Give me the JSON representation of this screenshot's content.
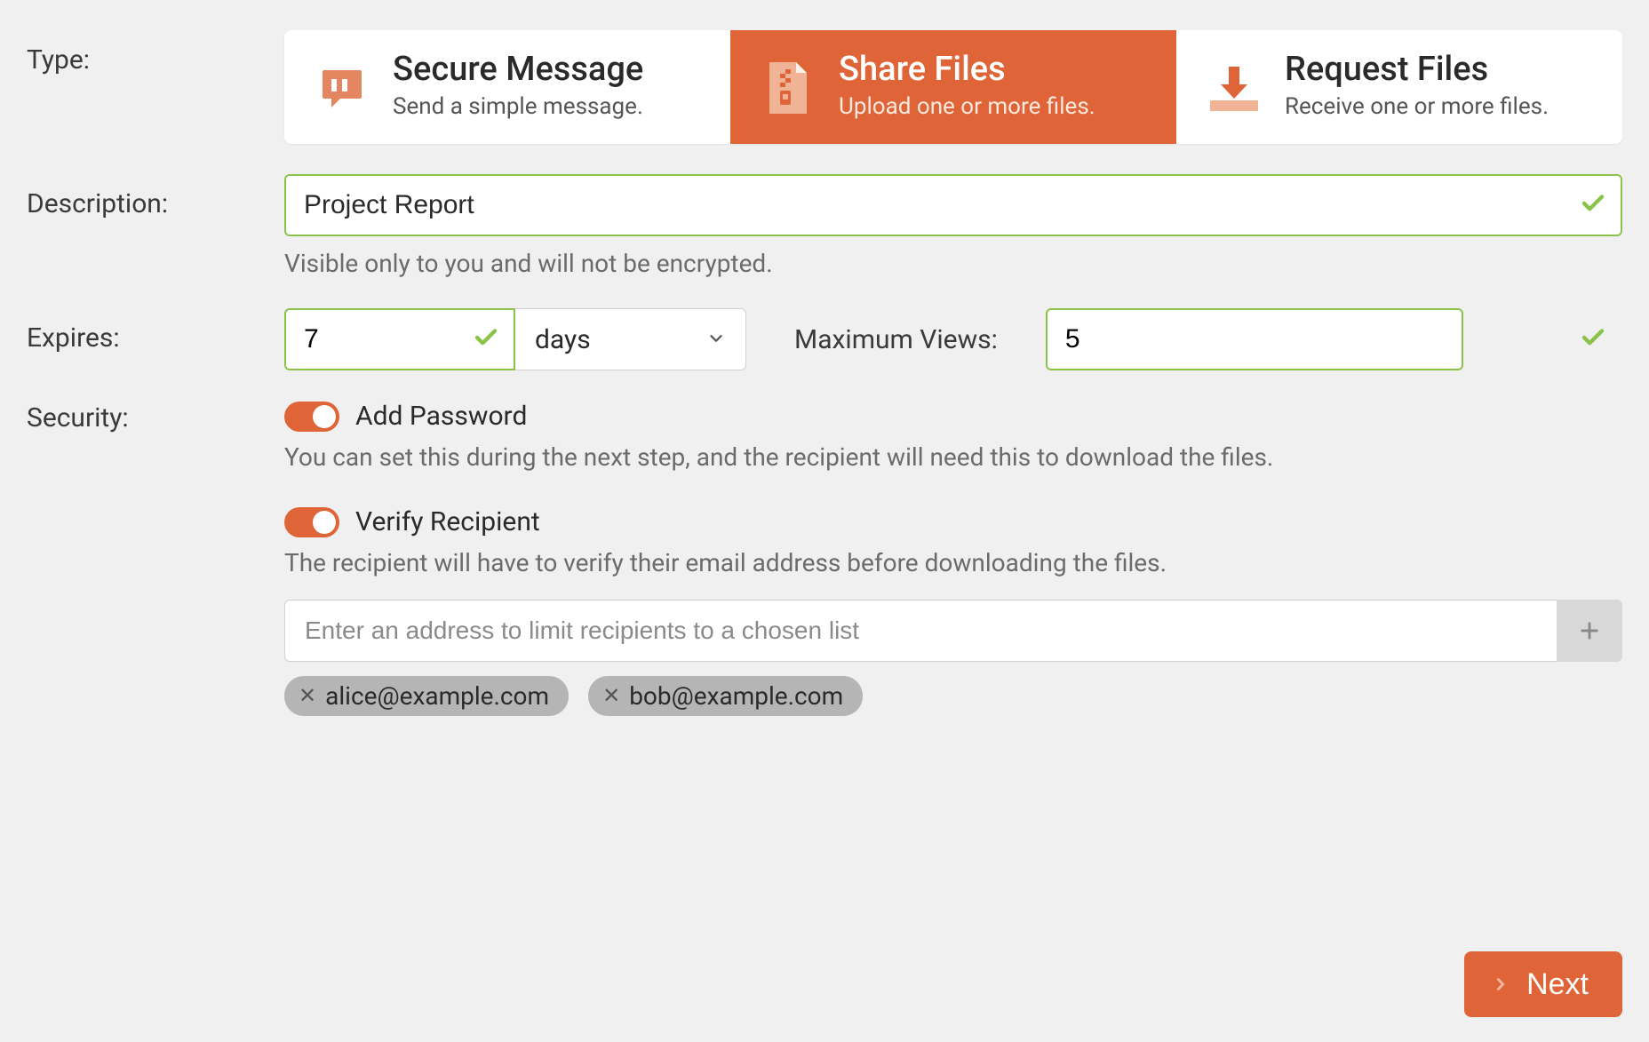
{
  "labels": {
    "type": "Type:",
    "description": "Description:",
    "expires": "Expires:",
    "max_views": "Maximum Views:",
    "security": "Security:"
  },
  "type_options": [
    {
      "title": "Secure Message",
      "subtitle": "Send a simple message.",
      "selected": false
    },
    {
      "title": "Share Files",
      "subtitle": "Upload one or more files.",
      "selected": true
    },
    {
      "title": "Request Files",
      "subtitle": "Receive one or more files.",
      "selected": false
    }
  ],
  "description": {
    "value": "Project Report",
    "hint": "Visible only to you and will not be encrypted.",
    "valid": true
  },
  "expires": {
    "value": "7",
    "unit": "days",
    "valid": true
  },
  "max_views": {
    "value": "5",
    "valid": true
  },
  "security": {
    "add_password": {
      "label": "Add Password",
      "enabled": true,
      "hint": "You can set this during the next step, and the recipient will need this to download the files."
    },
    "verify_recipient": {
      "label": "Verify Recipient",
      "enabled": true,
      "hint": "The recipient will have to verify their email address before downloading the files.",
      "input_placeholder": "Enter an address to limit recipients to a chosen list",
      "recipients": [
        "alice@example.com",
        "bob@example.com"
      ]
    }
  },
  "footer": {
    "next": "Next"
  }
}
